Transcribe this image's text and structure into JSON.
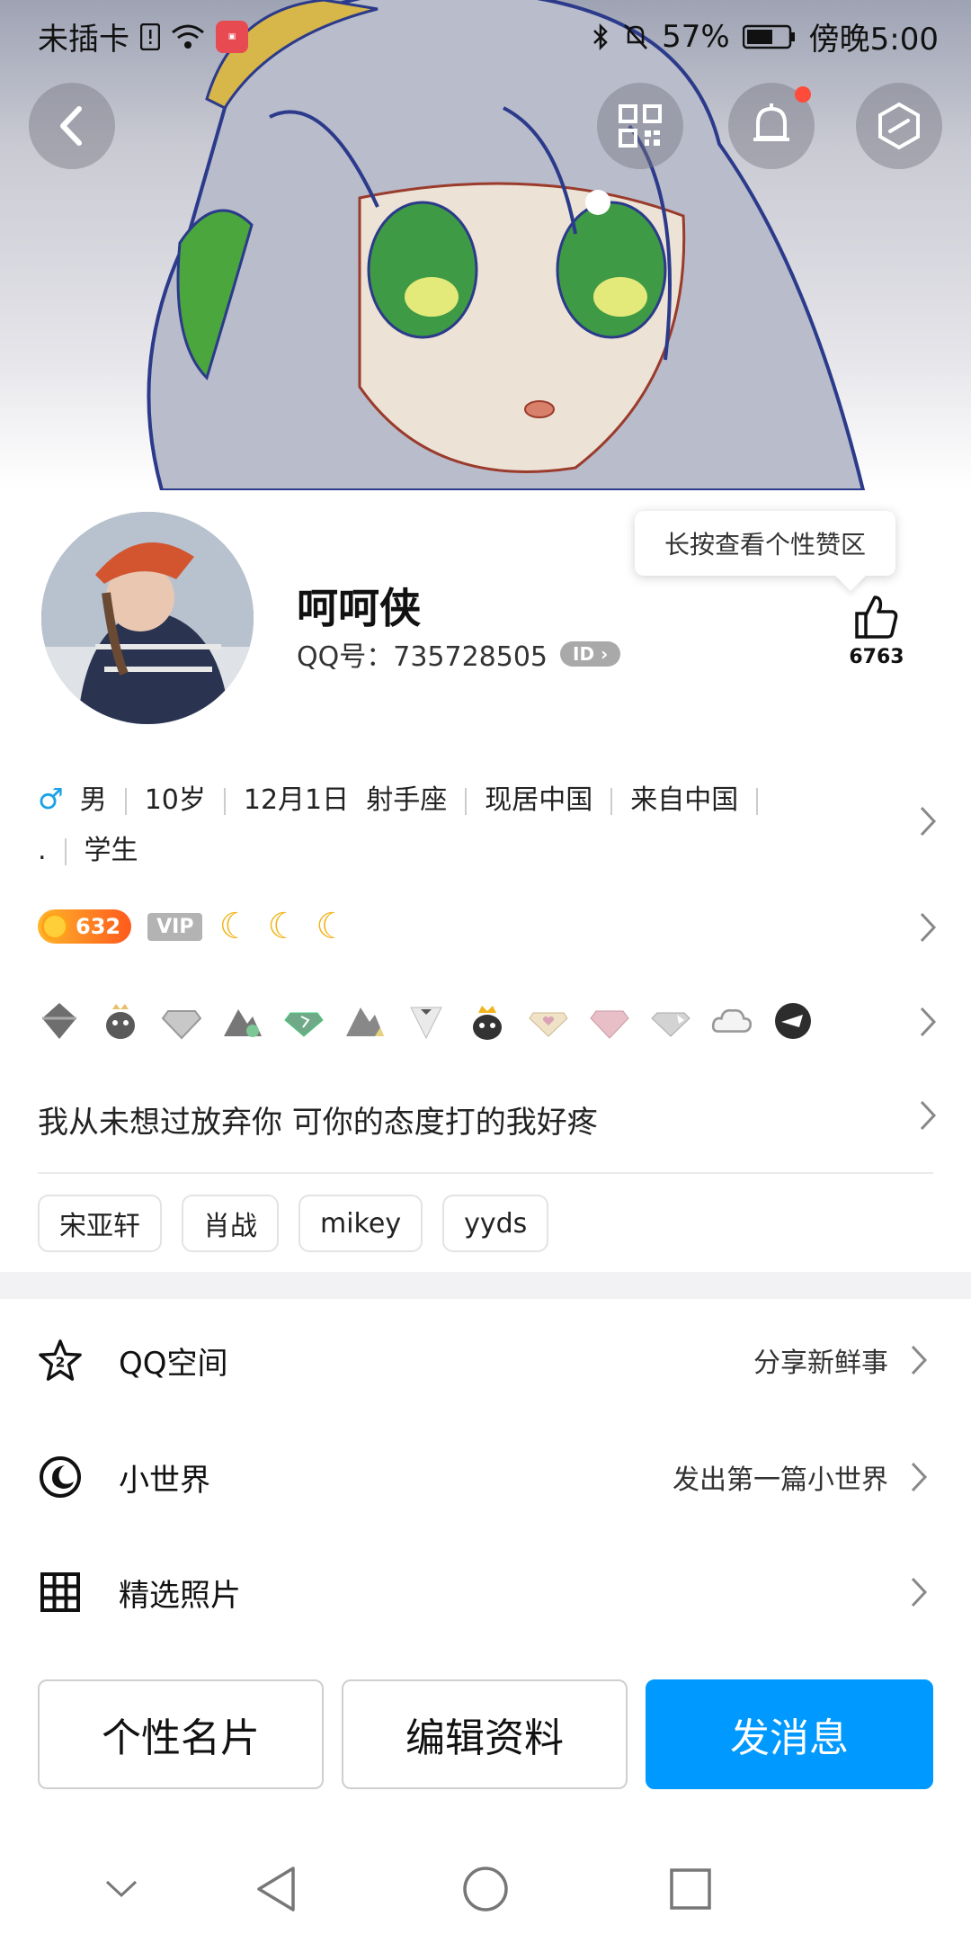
{
  "status_bar": {
    "carrier": "未插卡",
    "battery": "57%",
    "time": "傍晚5:00"
  },
  "header": {
    "icons": [
      "back-icon",
      "qr-code-icon",
      "bell-icon",
      "hexagon-menu-icon"
    ]
  },
  "profile": {
    "nickname": "呵呵侠",
    "qq_label": "QQ号：735728505",
    "id_badge": "ID",
    "tooltip": "长按查看个性赞区",
    "like_count": "6763"
  },
  "basic_info": {
    "gender": "男",
    "age": "10岁",
    "birthday": "12月1日",
    "zodiac": "射手座",
    "residence": "现居中国",
    "hometown": "来自中国",
    "dot": ".",
    "occupation": "学生"
  },
  "level": {
    "coins": "632",
    "vip": "VIP"
  },
  "signature": "我从未想过放弃你 可你的态度打的我好疼",
  "tags": [
    "宋亚轩",
    "肖战",
    "mikey",
    "yyds"
  ],
  "menu": [
    {
      "label": "QQ空间",
      "right": "分享新鲜事",
      "icon": "qzone-star-icon"
    },
    {
      "label": "小世界",
      "right": "发出第一篇小世界",
      "icon": "small-world-icon"
    },
    {
      "label": "精选照片",
      "right": "",
      "icon": "grid-photos-icon"
    }
  ],
  "buttons": {
    "card": "个性名片",
    "edit": "编辑资料",
    "message": "发消息"
  },
  "colors": {
    "primary": "#0099ff",
    "male": "#1aa1e6",
    "notification": "#ff4b3a"
  }
}
